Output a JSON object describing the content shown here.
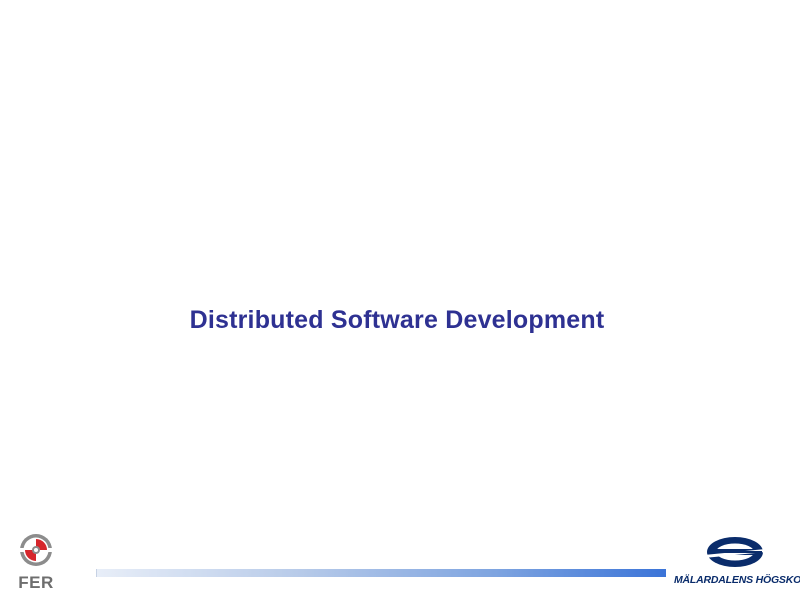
{
  "slide": {
    "title": "Distributed Software Development"
  },
  "footer": {
    "left_logo": {
      "text": "FER",
      "icon": "fer-emblem-icon"
    },
    "right_logo": {
      "text": "MÄLARDALENS HÖGSKOLA",
      "icon": "mdh-emblem-icon"
    },
    "bar_colors": [
      "#e8eef8",
      "#3b74d8"
    ]
  },
  "colors": {
    "title": "#2e3192",
    "logo_dark": "#0a2c6b",
    "logo_red": "#d6262c"
  }
}
